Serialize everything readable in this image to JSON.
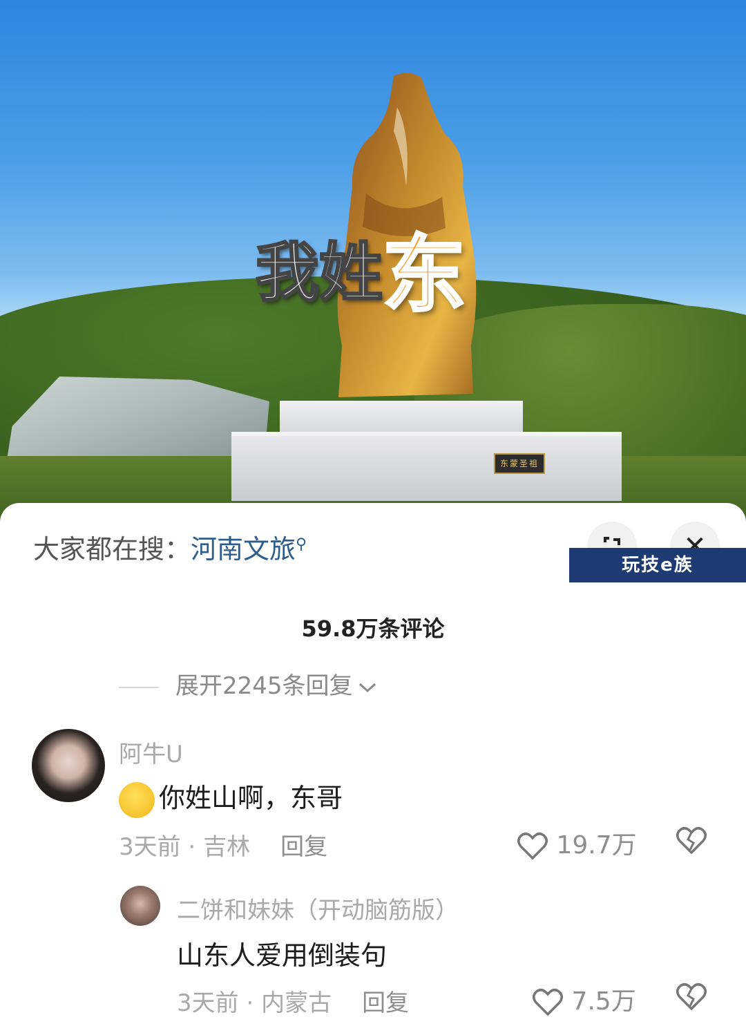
{
  "video": {
    "overlay_title_part1": "我姓",
    "overlay_title_part2": "东",
    "plaque_text": "东蒙圣祖"
  },
  "search": {
    "prefix": "大家都在搜：",
    "keyword": "河南文旅"
  },
  "watermark": "玩技e族",
  "comments_count": "59.8万条评论",
  "expand_replies": "展开2245条回复",
  "comments": [
    {
      "user": "阿牛U",
      "text": "你姓山啊，东哥",
      "time": "3天前",
      "location": "吉林",
      "reply_label": "回复",
      "likes": "19.7万"
    },
    {
      "user": "二饼和妹妹（开动脑筋版）",
      "text": "山东人爱用倒装句",
      "time": "3天前",
      "location": "内蒙古",
      "reply_label": "回复",
      "likes": "7.5万"
    }
  ],
  "colors": {
    "keyword": "#2d5d8f",
    "watermark_bg": "#1e3a73",
    "title_accent": "#f7a233"
  }
}
